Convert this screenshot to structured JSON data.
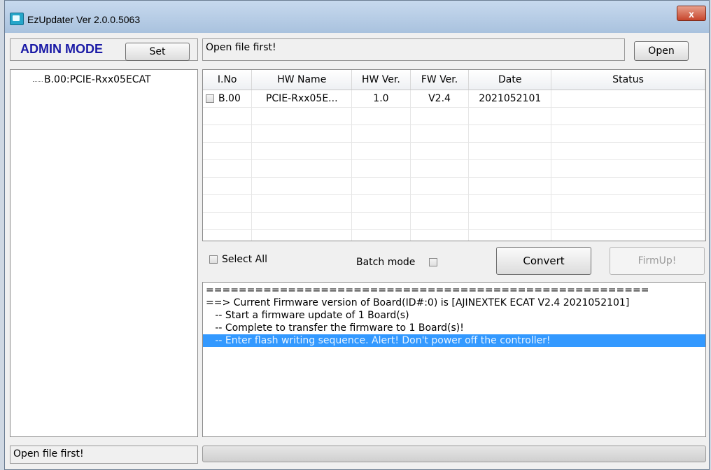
{
  "window": {
    "title": "EzUpdater Ver 2.0.0.5063",
    "close_glyph": "x"
  },
  "header": {
    "mode_label": "ADMIN MODE",
    "set_label": "Set",
    "file_status": "Open file first!",
    "open_label": "Open"
  },
  "tree": {
    "items": [
      "B.00:PCIE-Rxx05ECAT"
    ]
  },
  "table": {
    "headers": [
      "I.No",
      "HW Name",
      "HW Ver.",
      "FW Ver.",
      "Date",
      "Status"
    ],
    "rows": [
      {
        "ino": "B.00",
        "hw_name": "PCIE-Rxx05E...",
        "hw_ver": "1.0",
        "fw_ver": "V2.4",
        "date": "2021052101",
        "status": ""
      }
    ]
  },
  "controls": {
    "select_all_label": "Select All",
    "batch_mode_label": "Batch mode",
    "convert_label": "Convert",
    "firmup_label": "FirmUp!"
  },
  "log": {
    "lines": [
      "======================================================",
      "==> Current Firmware version of Board(ID#:0) is [AJINEXTEK ECAT V2.4 2021052101]",
      "   -- Start a firmware update of 1 Board(s)",
      "   -- Complete to transfer the firmware to 1 Board(s)!",
      "   -- Enter flash writing sequence. Alert! Don't power off the controller!"
    ],
    "highlighted_index": 4
  },
  "status_bar": {
    "message": "Open file first!"
  },
  "colors": {
    "admin_text": "#1a1aa6",
    "highlight": "#3399ff"
  }
}
